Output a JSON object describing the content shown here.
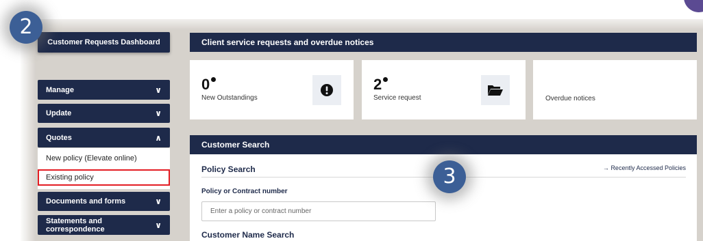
{
  "steps": {
    "left": "2",
    "middle": "3"
  },
  "sidebar": {
    "dashboard_label": "Customer Requests Dashboard",
    "items": [
      {
        "label": "Manage",
        "chevron": "down"
      },
      {
        "label": "Update",
        "chevron": "down"
      },
      {
        "label": "Quotes",
        "chevron": "up"
      },
      {
        "label": "Documents and forms",
        "chevron": "down"
      },
      {
        "label": "Statements and correspondence",
        "chevron": "down"
      }
    ],
    "quotes_submenu": [
      {
        "label": "New policy (Elevate online)"
      },
      {
        "label": "Existing policy",
        "highlighted": true
      }
    ]
  },
  "overview": {
    "title": "Client service requests and overdue notices",
    "cards": [
      {
        "count": "0",
        "label": "New Outstandings",
        "icon": "exclamation-circle-icon"
      },
      {
        "count": "2",
        "label": "Service request",
        "icon": "folder-open-icon"
      },
      {
        "label": "Overdue notices"
      }
    ]
  },
  "customer_search": {
    "title": "Customer Search",
    "policy_search_title": "Policy Search",
    "recent_link": "Recently Accessed Policies",
    "policy_field_label": "Policy or Contract number",
    "policy_placeholder": "Enter a policy or contract number",
    "policy_value": "",
    "name_search_title": "Customer Name Search"
  },
  "colors": {
    "navy": "#1e2a4a",
    "highlight_red": "#e31c23",
    "step_badge": "#3c5f96",
    "background": "#d6d2cc"
  }
}
